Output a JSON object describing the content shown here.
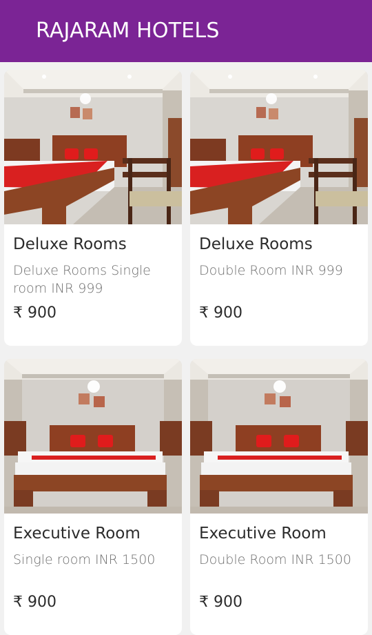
{
  "header": {
    "title": "RAJARAM HOTELS",
    "background": "#7b2495"
  },
  "rooms": [
    {
      "title": "Deluxe Rooms",
      "description": "Deluxe Rooms Single room INR 999",
      "price": "₹ 900",
      "image": "hotel-room-photo-1"
    },
    {
      "title": "Deluxe Rooms",
      "description": "Double Room INR 999",
      "price": "₹ 900",
      "image": "hotel-room-photo-1"
    },
    {
      "title": "Executive Room",
      "description": "Single room INR 1500",
      "price": "₹ 900",
      "image": "hotel-room-photo-2"
    },
    {
      "title": "Executive Room",
      "description": "Double Room INR 1500",
      "price": "₹ 900",
      "image": "hotel-room-photo-2"
    }
  ]
}
